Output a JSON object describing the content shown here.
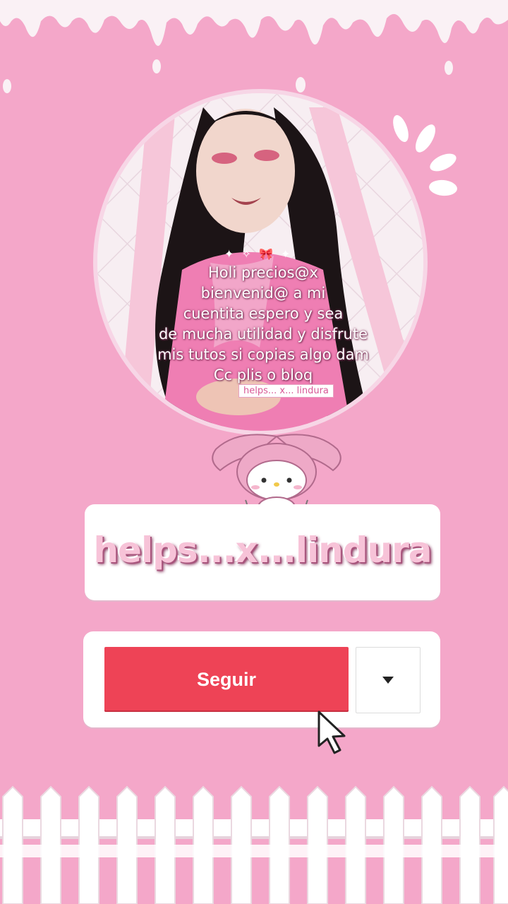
{
  "avatar": {
    "caption": "Holi precios@x\nbienvenid@ a mi\ncuentita espero y sea\nde mucha utilidad y disfrute\nmis tutos si copias algo dam\nCc plis o bloq",
    "tag": "helps... x... lindura",
    "sparkles": "✦ ✧ 🎀 ✦"
  },
  "profile": {
    "username": "helps...x...lindura"
  },
  "actions": {
    "follow_label": "Seguir",
    "more_icon": "caret-down-icon"
  },
  "colors": {
    "background": "#f4a7c9",
    "follow_button": "#ee4356",
    "card": "#ffffff"
  }
}
